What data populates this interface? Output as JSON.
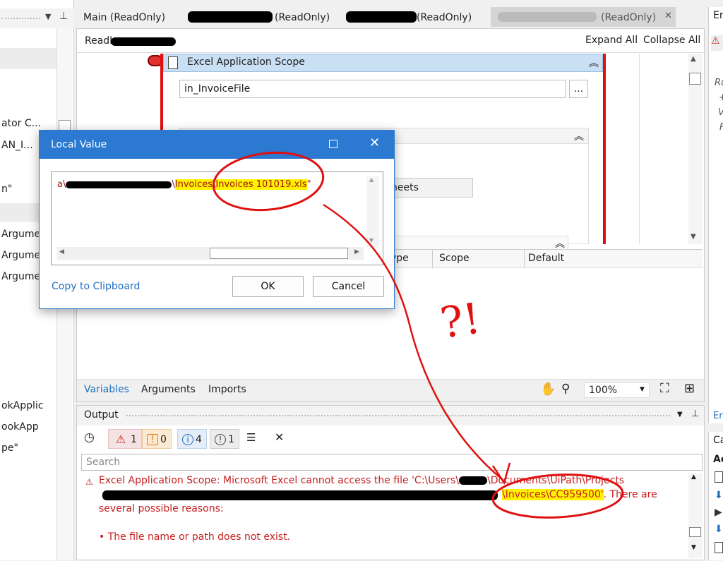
{
  "left_panel": {
    "items": [
      "ator C...",
      "AN_I...",
      "n\"",
      "Argume",
      "Argume",
      "Argume",
      "okApplic",
      "ookApp",
      "pe\""
    ]
  },
  "tabs": {
    "main": "Main (ReadOnly)",
    "tab2_suffix": "(ReadOnly)",
    "tab3_suffix": "(ReadOnly)",
    "tab4_suffix": "(ReadOnly)"
  },
  "designer": {
    "breadcrumb_prefix": "ReadI",
    "expand_all": "Expand All",
    "collapse_all": "Collapse All",
    "activity_title": "Excel Application Scope",
    "file_path_value": "in_InvoiceFile",
    "browse_button": "...",
    "sheets_label": "heets"
  },
  "variables_grid": {
    "columns": [
      "ype",
      "Scope",
      "Default"
    ]
  },
  "bottom_tabs": {
    "variables": "Variables",
    "arguments": "Arguments",
    "imports": "Imports",
    "zoom": "100%"
  },
  "dialog": {
    "title": "Local Value",
    "value_prefix": "a\\",
    "value_mid": "\\",
    "value_hl_folder": "Invoices",
    "value_sep": "\\",
    "value_hl_file": "Invoices 101019.xls",
    "value_end": "\"",
    "copy_link": "Copy to Clipboard",
    "ok": "OK",
    "cancel": "Cancel"
  },
  "output": {
    "title": "Output",
    "counts": {
      "errors": "1",
      "warnings": "0",
      "info": "4",
      "trace": "1"
    },
    "search_placeholder": "Search",
    "error_line1": "Excel Application Scope: Microsoft Excel cannot access the file 'C:\\Users\\",
    "error_line1_end": "\\Documents\\UiPath\\Projects",
    "error_hl": "\\Invoices\\CC959500'",
    "error_line2_end": ". There are",
    "error_line3": "several possible reasons:",
    "error_bullet": "• The file name or path does not exist."
  },
  "annotation": {
    "text": "?!"
  },
  "right_panel": {
    "title": "Er",
    "lines": [
      "Ru",
      "+",
      "V",
      "F"
    ],
    "link": "Er",
    "bottom_title": "Ca",
    "bottom_sub": "Ac"
  },
  "colors": {
    "accent_blue": "#1e6fbf",
    "dialog_title_bg": "#2b79d0",
    "activity_header_bg": "#c9dff3",
    "annotation_red": "#e01010",
    "highlight": "#fff200",
    "error_red": "#c81e1e"
  }
}
